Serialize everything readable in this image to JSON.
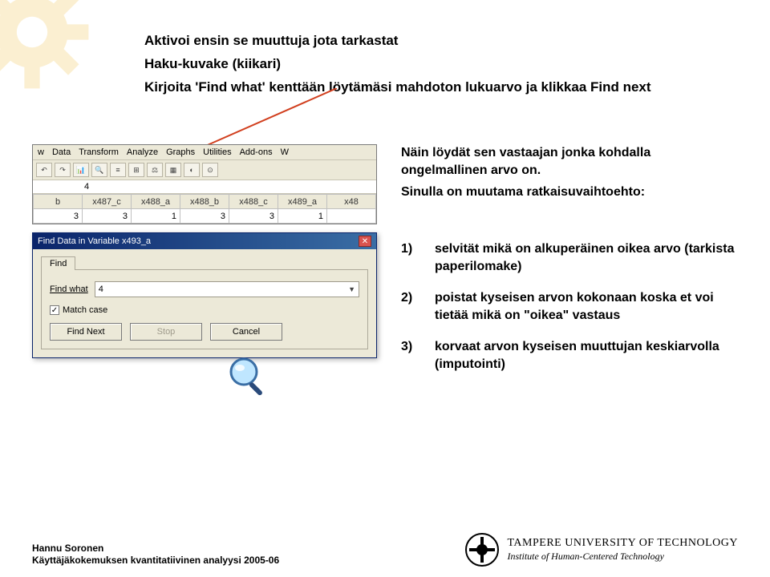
{
  "intro": {
    "line1": "Aktivoi ensin se muuttuja jota tarkastat",
    "line2": "Haku-kuvake (kiikari)",
    "line3": "Kirjoita 'Find what' kenttään löytämäsi mahdoton lukuarvo ja klikkaa Find next"
  },
  "spss": {
    "menu": [
      "w",
      "Data",
      "Transform",
      "Analyze",
      "Graphs",
      "Utilities",
      "Add-ons",
      "W"
    ],
    "cell_value": "4",
    "cols": [
      "b",
      "x487_c",
      "x488_a",
      "x488_b",
      "x488_c",
      "x489_a",
      "x48"
    ],
    "row": [
      "3",
      "3",
      "1",
      "3",
      "3",
      "1",
      ""
    ]
  },
  "dialog": {
    "title": "Find Data in Variable x493_a",
    "tab": "Find",
    "find_what_label": "Find what",
    "find_what_value": "4",
    "match_case": "Match case",
    "buttons": {
      "find_next": "Find Next",
      "stop": "Stop",
      "cancel": "Cancel"
    }
  },
  "right": {
    "para1": "Näin löydät sen vastaajan jonka kohdalla ongelmallinen arvo on.",
    "para2": "Sinulla on muutama ratkaisuvaihtoehto:"
  },
  "solutions": [
    {
      "n": "1)",
      "text": "selvität mikä on alkuperäinen oikea arvo (tarkista paperilomake)"
    },
    {
      "n": "2)",
      "text": "poistat kyseisen arvon kokonaan koska et voi tietää mikä on \"oikea\" vastaus"
    },
    {
      "n": "3)",
      "text": "korvaat arvon kyseisen muuttujan keskiarvolla (imputointi)"
    }
  ],
  "footer": {
    "author": "Hannu Soronen",
    "course": "Käyttäjäkokemuksen kvantitatiivinen analyysi 2005-06",
    "uni1": "TAMPERE UNIVERSITY OF TECHNOLOGY",
    "uni2": "Institute of Human-Centered Technology"
  }
}
